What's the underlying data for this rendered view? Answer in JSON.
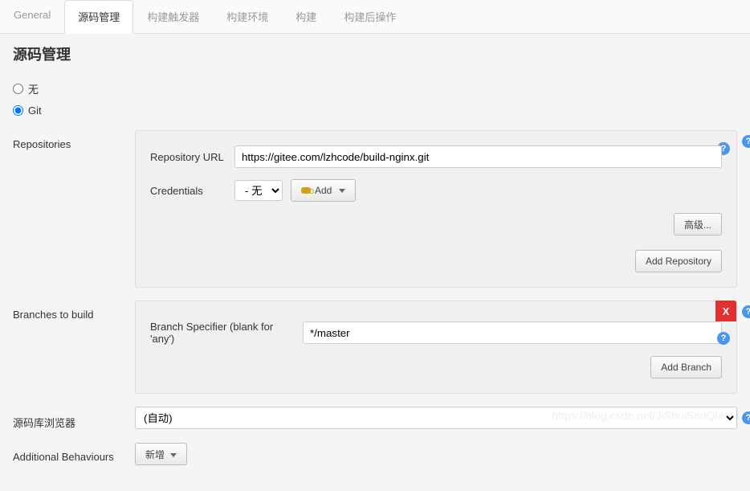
{
  "tabs": [
    "General",
    "源码管理",
    "构建触发器",
    "构建环境",
    "构建",
    "构建后操作"
  ],
  "active_tab": "源码管理",
  "section_title": "源码管理",
  "scm_options": {
    "none": "无",
    "git": "Git"
  },
  "labels": {
    "repositories": "Repositories",
    "repo_url": "Repository URL",
    "credentials": "Credentials",
    "advanced": "高级...",
    "add_repo": "Add Repository",
    "branches": "Branches to build",
    "branch_spec": "Branch Specifier (blank for 'any')",
    "add_branch": "Add Branch",
    "browser": "源码库浏览器",
    "additional": "Additional Behaviours",
    "add_behaviour": "新增",
    "add_cred": "Add"
  },
  "values": {
    "repo_url": "https://gitee.com/lzhcode/build-nginx.git",
    "credentials_selected": "- 无 -",
    "branch_spec": "*/master",
    "browser_selected": "(自动)"
  },
  "watermark": "https://blog.csdn.net/JiShuiSanQianLi"
}
